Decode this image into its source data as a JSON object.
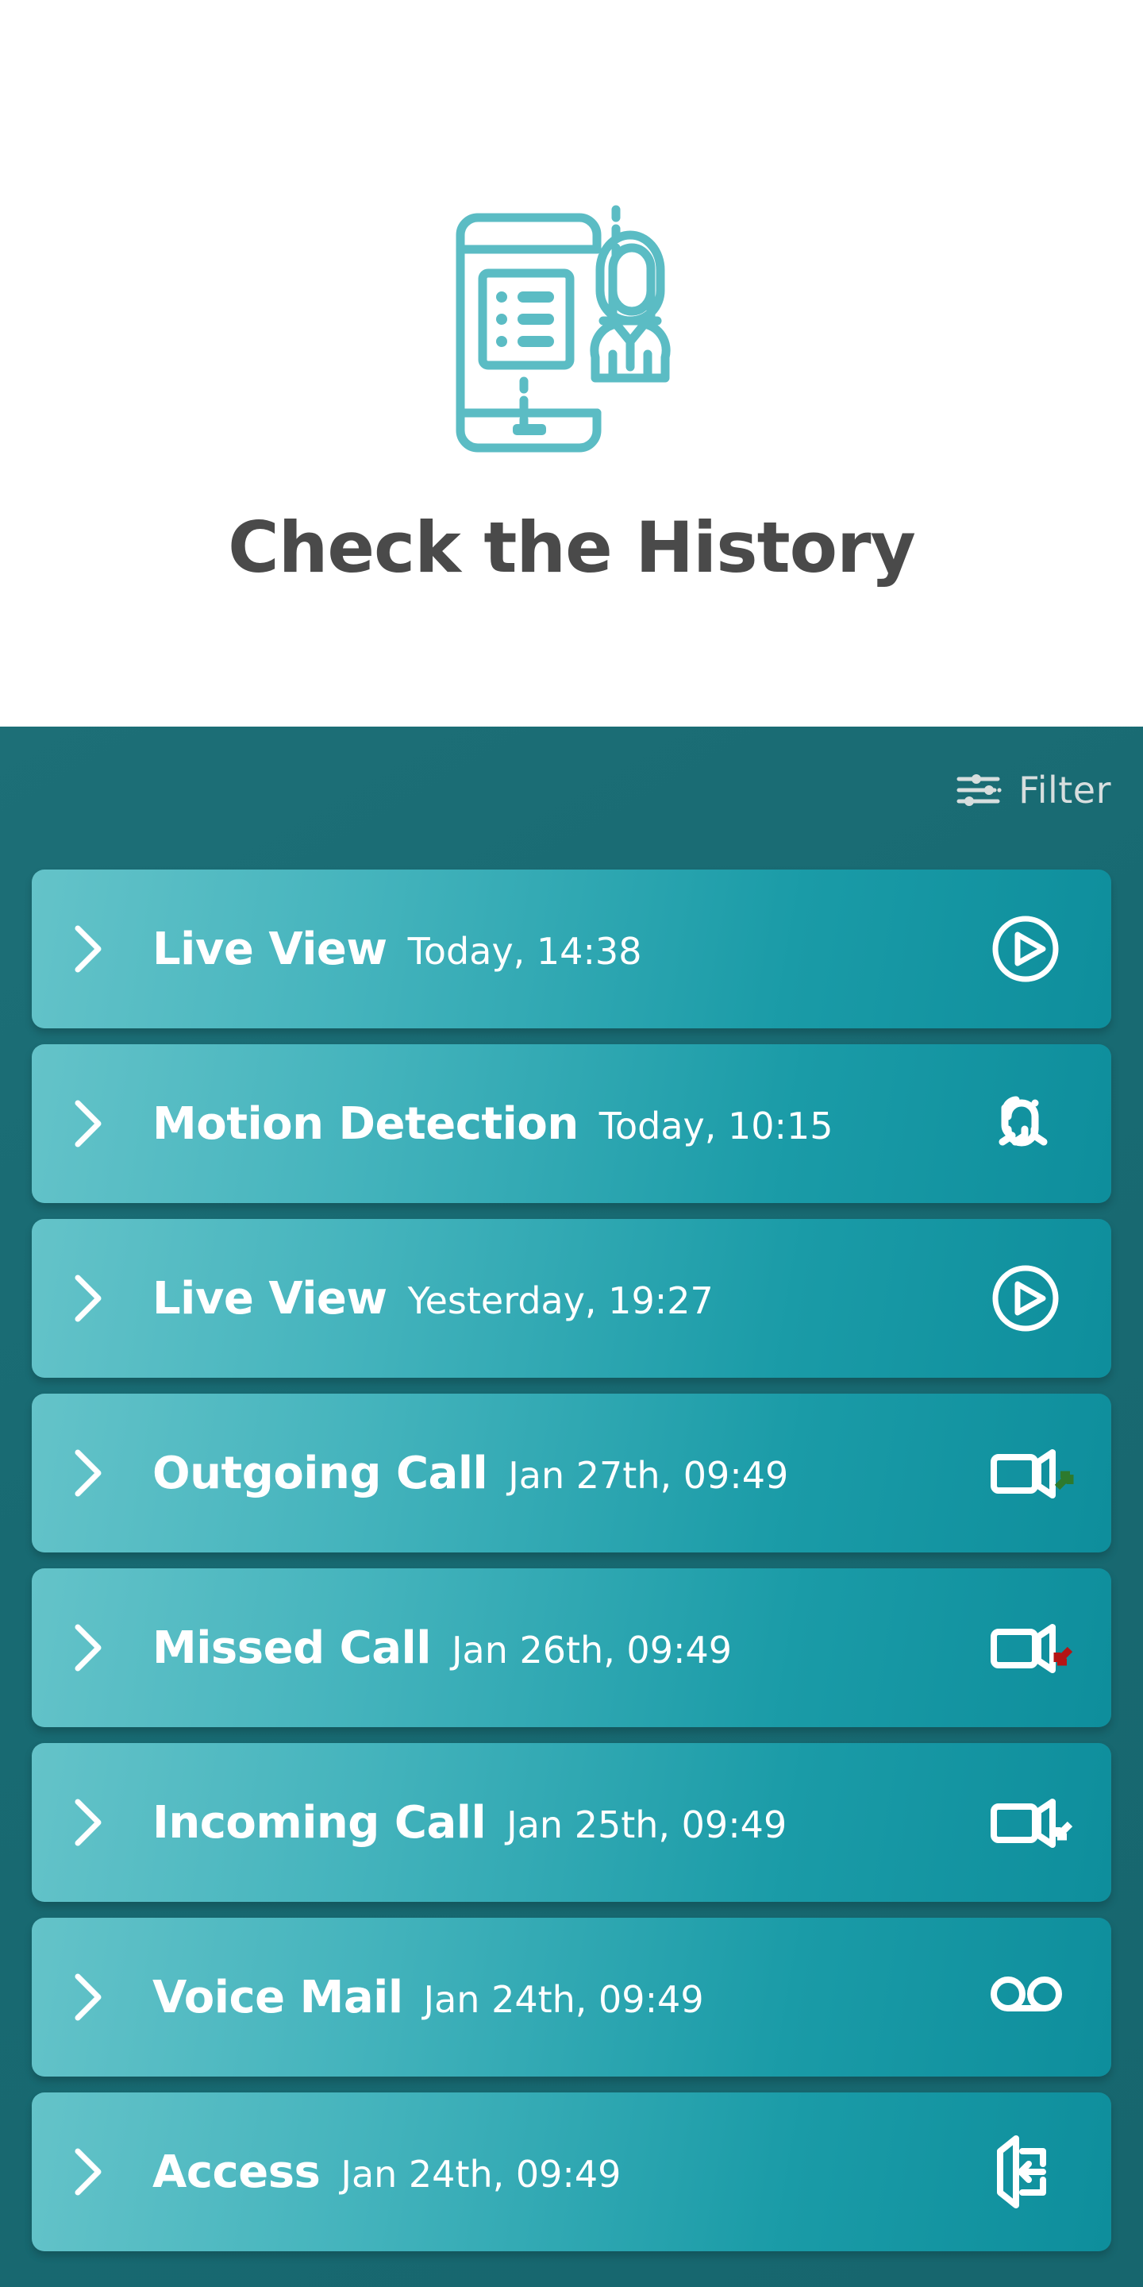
{
  "hero": {
    "title": "Check the History",
    "illustration_name": "phone-with-person-list-illustration",
    "accent_color": "#5bbcc4"
  },
  "panel": {
    "background_color": "#1a6b73",
    "filter": {
      "label": "Filter",
      "icon": "sliders-filter-icon"
    }
  },
  "list": {
    "rows": [
      {
        "title": "Live View",
        "time": "Today, 14:38",
        "icon": "play-circle-icon",
        "chevron": "chevron-right-icon"
      },
      {
        "title": "Motion Detection",
        "time": "Today, 10:15",
        "icon": "two-people-icon",
        "chevron": "chevron-right-icon"
      },
      {
        "title": "Live View",
        "time": "Yesterday, 19:27",
        "icon": "play-circle-icon",
        "chevron": "chevron-right-icon"
      },
      {
        "title": "Outgoing Call",
        "time": "Jan 27th, 09:49",
        "icon": "video-call-outgoing-icon",
        "chevron": "chevron-right-icon"
      },
      {
        "title": "Missed Call",
        "time": "Jan 26th, 09:49",
        "icon": "video-call-missed-icon",
        "chevron": "chevron-right-icon"
      },
      {
        "title": "Incoming Call",
        "time": "Jan 25th, 09:49",
        "icon": "video-call-incoming-icon",
        "chevron": "chevron-right-icon"
      },
      {
        "title": "Voice Mail",
        "time": "Jan 24th, 09:49",
        "icon": "voicemail-icon",
        "chevron": "chevron-right-icon"
      },
      {
        "title": "Access",
        "time": "Jan 24th, 09:49",
        "icon": "door-access-icon",
        "chevron": "chevron-right-icon"
      }
    ],
    "colors": {
      "card_light": "#64c3c9",
      "card_dark": "#0e8e9c",
      "outgoing_arrow": "#2d7a2d",
      "missed_arrow": "#b51515",
      "incoming_arrow": "#ffffff"
    }
  }
}
